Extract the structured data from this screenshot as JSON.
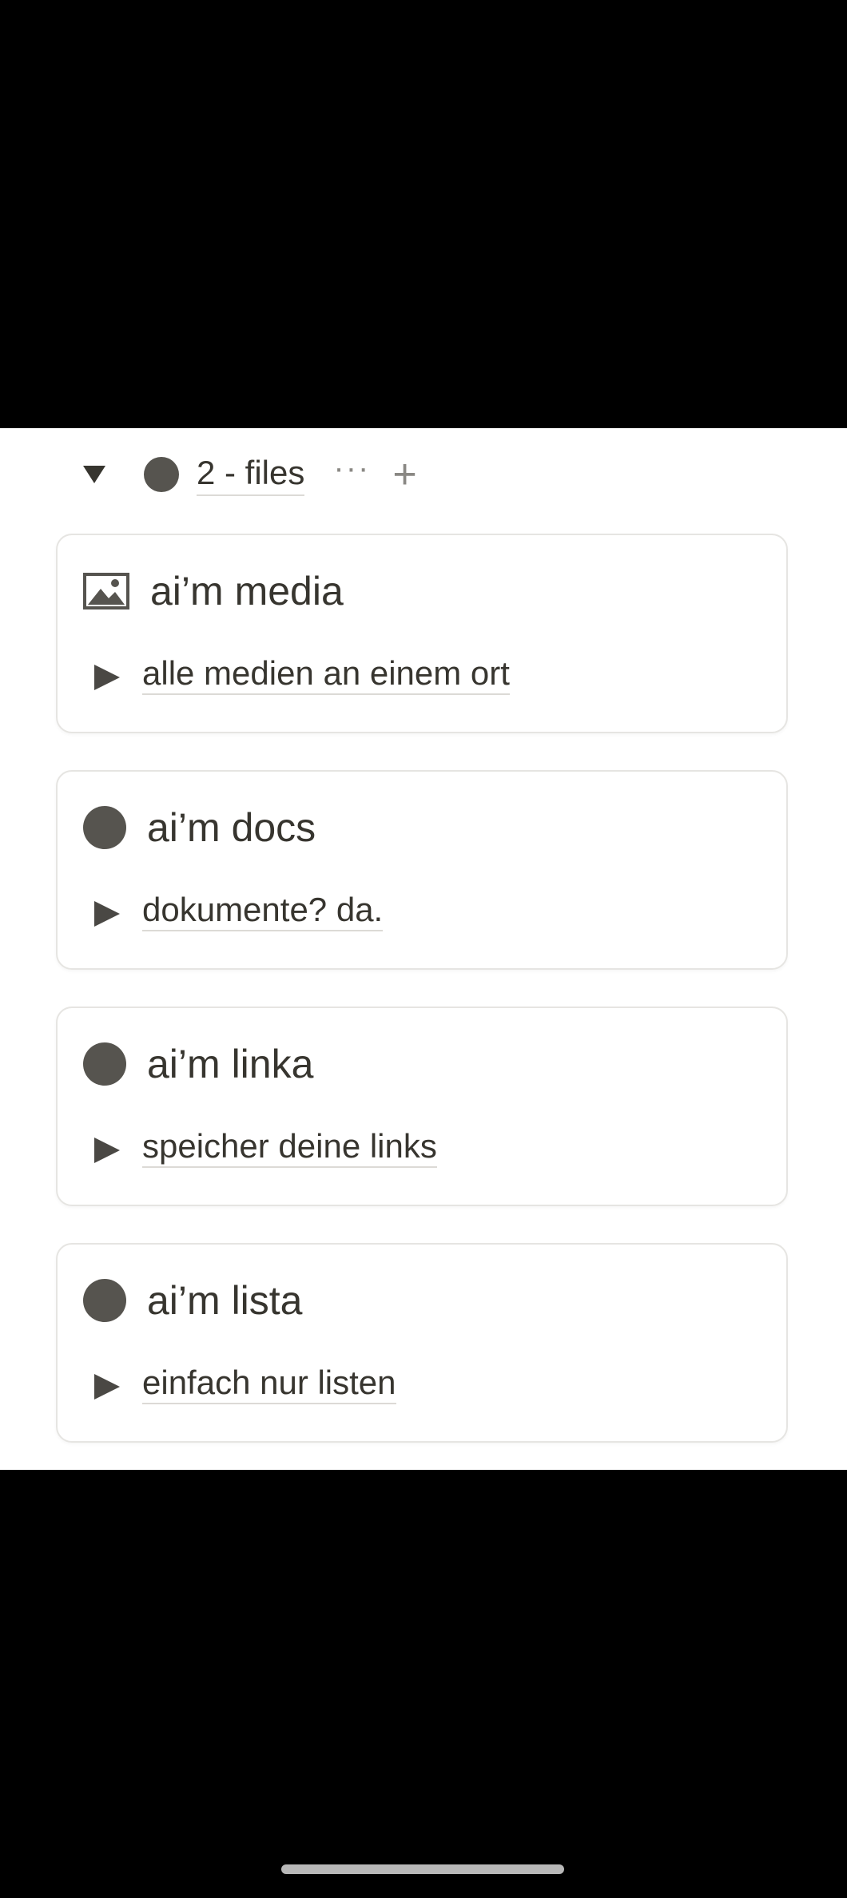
{
  "group": {
    "title": "2 - files",
    "more_icon": "···",
    "add_icon": "+"
  },
  "cards": [
    {
      "icon": "image-icon",
      "title": "ai’m media",
      "description": "alle medien an einem ort"
    },
    {
      "icon": "circle-icon",
      "title": "ai’m docs",
      "description": "dokumente? da."
    },
    {
      "icon": "circle-icon",
      "title": "ai’m linka",
      "description": "speicher deine links"
    },
    {
      "icon": "circle-icon",
      "title": "ai’m lista",
      "description": "einfach nur listen"
    }
  ],
  "colors": {
    "text": "#37352f",
    "icon_gray": "#56544f",
    "border": "#e6e5e2",
    "background": "#ffffff"
  }
}
